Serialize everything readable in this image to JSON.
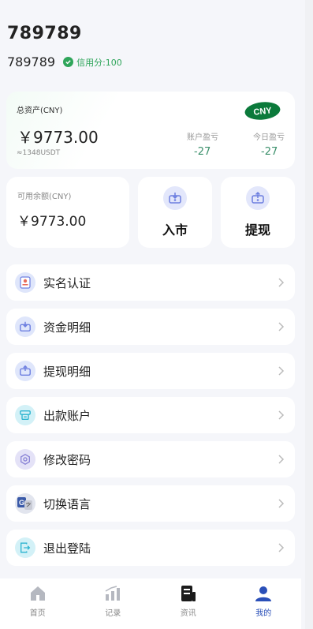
{
  "user": {
    "name": "789789",
    "id": "789789",
    "credit_label": "信用分:100"
  },
  "assets": {
    "label": "总资产(CNY)",
    "currency_badge": "CNY",
    "value": "￥9773.00",
    "usdt": "≈1348USDT",
    "account_pnl_label": "账户盈亏",
    "account_pnl_value": "-27",
    "today_pnl_label": "今日盈亏",
    "today_pnl_value": "-27"
  },
  "balance": {
    "label": "可用余额(CNY)",
    "value": "￥9773.00"
  },
  "actions": [
    {
      "label": "入市",
      "icon": "deposit-icon"
    },
    {
      "label": "提现",
      "icon": "withdraw-icon"
    }
  ],
  "menu": [
    {
      "label": "实名认证",
      "icon": "id-verify-icon"
    },
    {
      "label": "资金明细",
      "icon": "fund-detail-icon"
    },
    {
      "label": "提现明细",
      "icon": "withdraw-detail-icon"
    },
    {
      "label": "出款账户",
      "icon": "payout-account-icon"
    },
    {
      "label": "修改密码",
      "icon": "password-icon"
    },
    {
      "label": "切换语言",
      "icon": "language-icon"
    },
    {
      "label": "退出登陆",
      "icon": "logout-icon"
    }
  ],
  "tabs": [
    {
      "label": "首页",
      "icon": "home-icon",
      "active": false
    },
    {
      "label": "记录",
      "icon": "chart-icon",
      "active": false
    },
    {
      "label": "资讯",
      "icon": "news-icon",
      "active": false
    },
    {
      "label": "我的",
      "icon": "profile-icon",
      "active": true
    }
  ],
  "colors": {
    "accent": "#2a4fb8",
    "positive": "#2fa55a",
    "badge": "#0b7a3b",
    "background": "#f5f6fa"
  }
}
